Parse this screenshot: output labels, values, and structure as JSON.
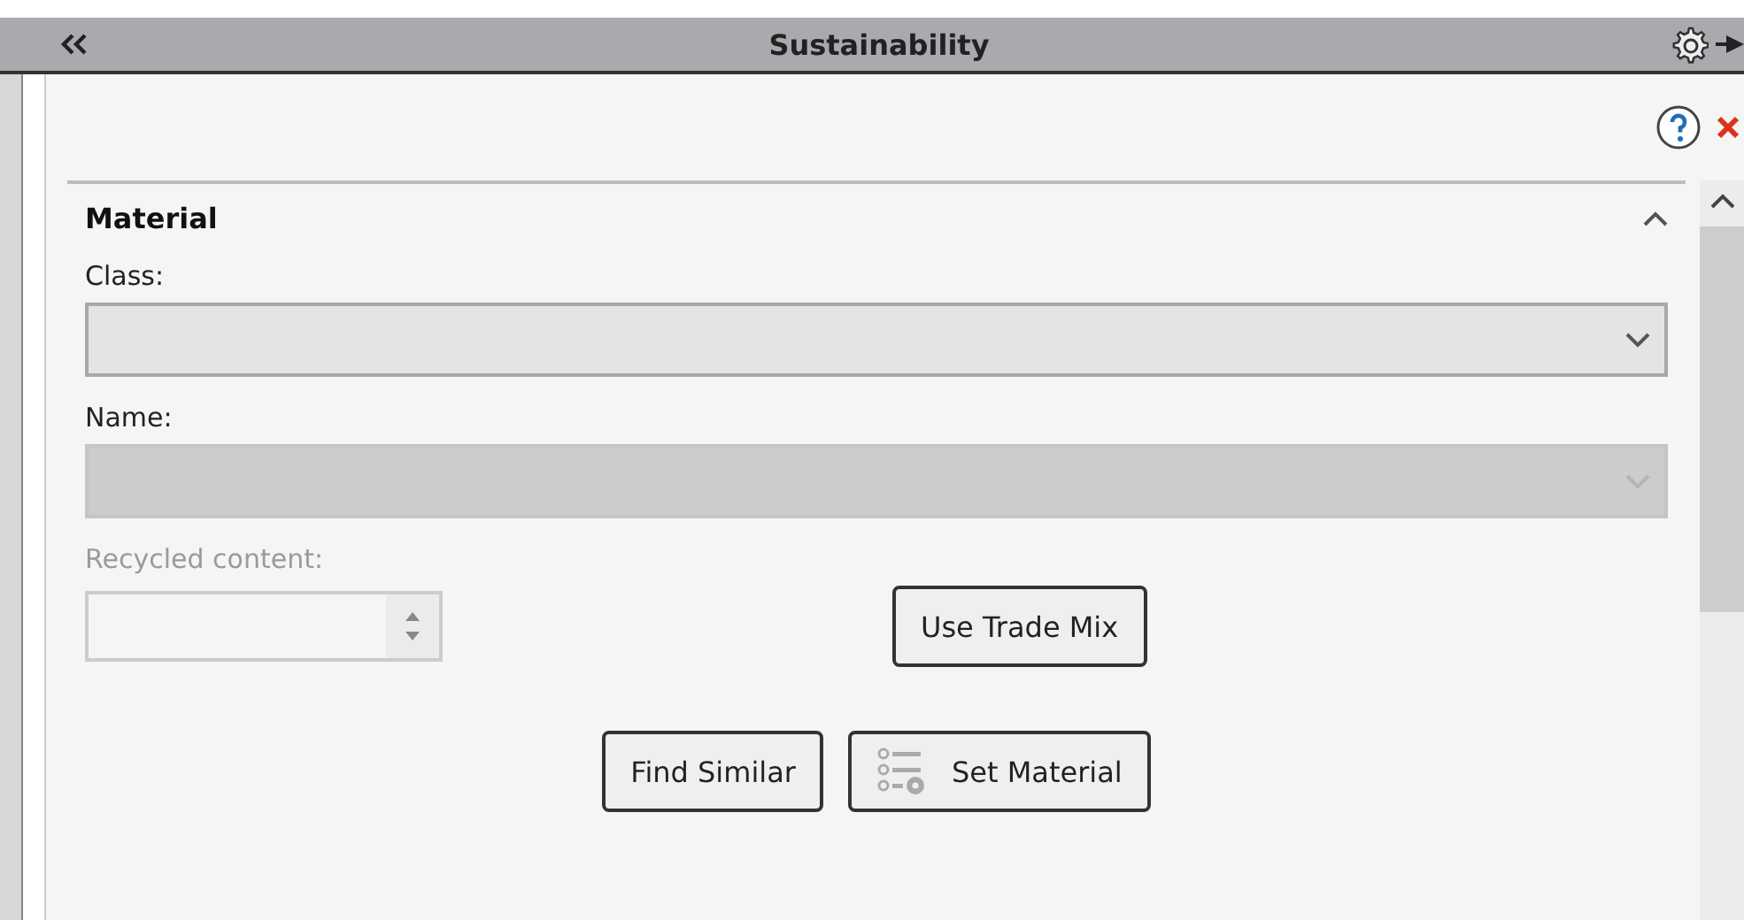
{
  "window": {
    "title": "Sustainability"
  },
  "section": {
    "title": "Material",
    "expanded": true
  },
  "fields": [
    {
      "label": "Class:",
      "kind": "dropdown",
      "disabled": false
    },
    {
      "label": "Name:",
      "kind": "dropdown",
      "disabled": true
    },
    {
      "label": "Recycled content:",
      "kind": "spinner",
      "disabled": true
    }
  ],
  "buttons": [
    {
      "label": "Use Trade Mix",
      "kind": "plain"
    },
    {
      "label": "Find Similar",
      "kind": "plain"
    },
    {
      "label": "Set Material",
      "kind": "list-icon"
    }
  ]
}
